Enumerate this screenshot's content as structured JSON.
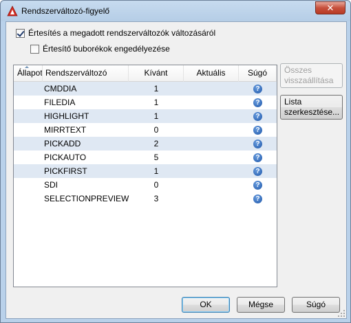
{
  "window": {
    "title": "Rendszerváltozó-figyelő",
    "close_label": "✕"
  },
  "options": {
    "notify_label": "Értesítés a megadott rendszerváltozók változásáról",
    "notify_checked": true,
    "balloon_label": "Értesítő buborékok engedélyezése",
    "balloon_checked": false
  },
  "list": {
    "headers": {
      "status": "Állapot",
      "name": "Rendszerváltozó",
      "preferred": "Kívánt",
      "current": "Aktuális",
      "help": "Súgó"
    },
    "rows": [
      {
        "name": "CMDDIA",
        "preferred": "1",
        "current": ""
      },
      {
        "name": "FILEDIA",
        "preferred": "1",
        "current": ""
      },
      {
        "name": "HIGHLIGHT",
        "preferred": "1",
        "current": ""
      },
      {
        "name": "MIRRTEXT",
        "preferred": "0",
        "current": ""
      },
      {
        "name": "PICKADD",
        "preferred": "2",
        "current": ""
      },
      {
        "name": "PICKAUTO",
        "preferred": "5",
        "current": ""
      },
      {
        "name": "PICKFIRST",
        "preferred": "1",
        "current": ""
      },
      {
        "name": "SDI",
        "preferred": "0",
        "current": ""
      },
      {
        "name": "SELECTIONPREVIEW",
        "preferred": "3",
        "current": ""
      }
    ]
  },
  "side_buttons": {
    "reset_all": "Összes visszaállítása",
    "edit_list": "Lista szerkesztése..."
  },
  "footer": {
    "ok": "OK",
    "cancel": "Mégse",
    "help": "Súgó"
  }
}
